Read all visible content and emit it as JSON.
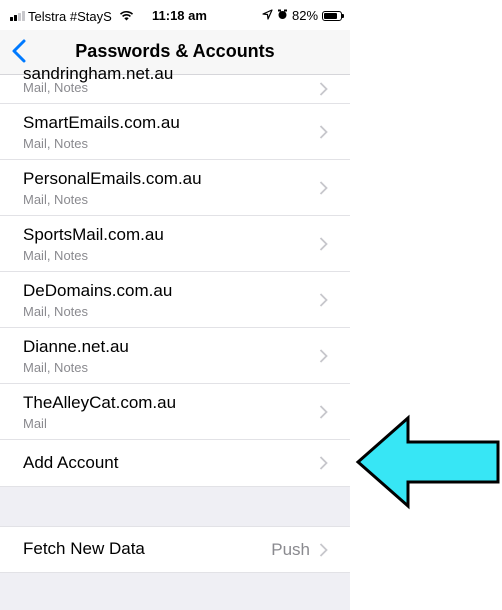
{
  "status_bar": {
    "carrier": "Telstra #StayS",
    "time": "11:18 am",
    "battery": "82%",
    "battery_level": 0.82
  },
  "nav": {
    "title": "Passwords & Accounts",
    "back_icon": "chevron-left-icon"
  },
  "accounts": [
    {
      "name": "sandringham.net.au",
      "detail": "Mail, Notes"
    },
    {
      "name": "SmartEmails.com.au",
      "detail": "Mail, Notes"
    },
    {
      "name": "PersonalEmails.com.au",
      "detail": "Mail, Notes"
    },
    {
      "name": "SportsMail.com.au",
      "detail": "Mail, Notes"
    },
    {
      "name": "DeDomains.com.au",
      "detail": "Mail, Notes"
    },
    {
      "name": "Dianne.net.au",
      "detail": "Mail, Notes"
    },
    {
      "name": "TheAlleyCat.com.au",
      "detail": "Mail"
    }
  ],
  "add_account": {
    "label": "Add Account"
  },
  "fetch": {
    "label": "Fetch New Data",
    "value": "Push"
  },
  "colors": {
    "ios_blue": "#007aff",
    "arrow_fill": "#37e6f5",
    "secondary_text": "#8a8a8f",
    "grouped_bg": "#efeff4"
  }
}
